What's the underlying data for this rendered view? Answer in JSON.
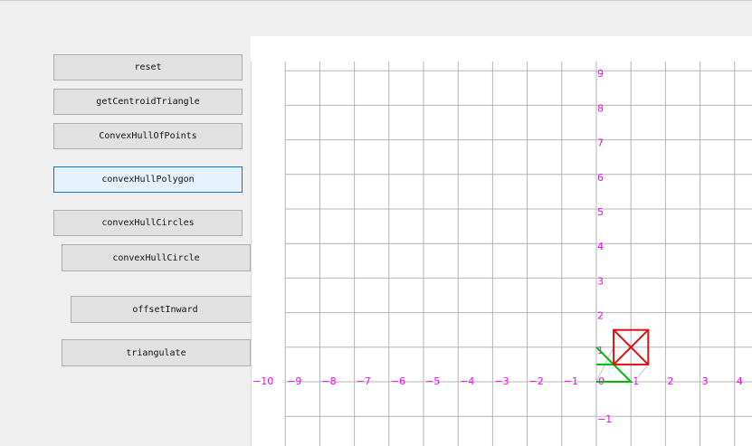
{
  "buttons": [
    {
      "label": "reset",
      "focused": false
    },
    {
      "label": "getCentroidTriangle",
      "focused": false
    },
    {
      "label": "ConvexHullOfPoints",
      "focused": false
    },
    {
      "label": "convexHullPolygon",
      "focused": true
    },
    {
      "label": "convexHullCircles",
      "focused": false
    },
    {
      "label": "convexHullCircle",
      "focused": false
    },
    {
      "label": "offsetInward",
      "focused": false
    },
    {
      "label": "triangulate",
      "focused": false
    }
  ],
  "plot": {
    "x_tick_labels": [
      "−10",
      "−9",
      "−8",
      "−7",
      "−6",
      "−5",
      "−4",
      "−3",
      "−2",
      "−1",
      "0",
      "1",
      "2",
      "3",
      "4"
    ],
    "y_tick_labels": [
      "9",
      "8",
      "7",
      "6",
      "5",
      "4",
      "3",
      "2",
      "1",
      "−1",
      "−2"
    ],
    "colors": {
      "grid": "#b4b4b4",
      "labels": "#ff00ff",
      "green": "#00bb00",
      "red": "#dd1111",
      "faint": "#c0c0e0"
    }
  }
}
